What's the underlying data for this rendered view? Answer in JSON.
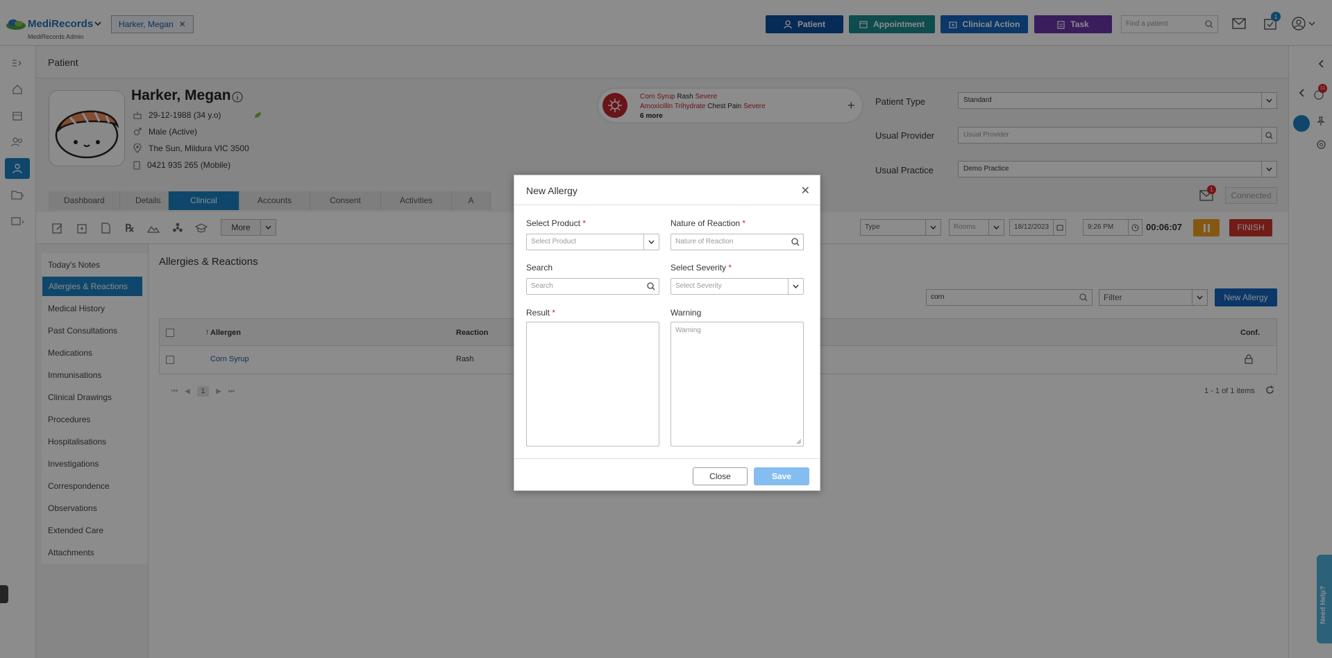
{
  "app": {
    "brand": "MediRecords",
    "subtitle": "MediRecords Admin"
  },
  "open_patient_tab": {
    "label": "Harker, Megan"
  },
  "top_buttons": [
    {
      "label": "Patient",
      "color": "#0d4f9e",
      "icon": "patient-icon"
    },
    {
      "label": "Appointment",
      "color": "#1b8a8c",
      "icon": "calendar-icon"
    },
    {
      "label": "Clinical Action",
      "color": "#1565c0",
      "icon": "clinical-icon"
    },
    {
      "label": "Task",
      "color": "#6a35a8",
      "icon": "task-icon"
    }
  ],
  "find_patient": {
    "placeholder": "Find a patient"
  },
  "notifications": {
    "tasks_badge": "1"
  },
  "page_header": {
    "title": "Patient"
  },
  "patient": {
    "name": "Harker, Megan",
    "dob": "29-12-1988 (34 y.o)",
    "sex": "Male (Active)",
    "address": "The Sun, Mildura VIC 3500",
    "phone": "0421 935 265 (Mobile)"
  },
  "allergy_alert": {
    "line1": {
      "allergen": "Corn Syrup",
      "reaction": "Rash",
      "severity": "Severe"
    },
    "line2": {
      "allergen": "Amoxicillin Trihydrate",
      "reaction": "Chest Pain",
      "severity": "Severe"
    },
    "more": "6 more"
  },
  "patient_fields": {
    "patient_type": {
      "label": "Patient Type",
      "value": "Standard"
    },
    "usual_provider": {
      "label": "Usual Provider",
      "placeholder": "Usual Provider"
    },
    "usual_practice": {
      "label": "Usual Practice",
      "value": "Demo Practice"
    }
  },
  "messages_badge": "1",
  "connected_label": "Connected",
  "tabs": [
    "Dashboard",
    "Details",
    "Clinical",
    "Accounts",
    "Consent",
    "Activities",
    "A"
  ],
  "active_tab": "Clinical",
  "toolbar": {
    "more_label": "More",
    "type_placeholder": "Type",
    "rooms_placeholder": "Rooms",
    "date": "18/12/2023",
    "time": "9:26 PM",
    "timer": "00:06:07",
    "finish_label": "FINISH"
  },
  "side_menu": [
    "Today's Notes",
    "Allergies & Reactions",
    "Medical History",
    "Past Consultations",
    "Medications",
    "Immunisations",
    "Clinical Drawings",
    "Procedures",
    "Hospitalisations",
    "Investigations",
    "Correspondence",
    "Observations",
    "Extended Care",
    "Attachments"
  ],
  "section": {
    "title": "Allergies & Reactions",
    "search_value": "corn",
    "filter_placeholder": "Filter",
    "new_button": "New Allergy"
  },
  "grid": {
    "columns": {
      "allergen": "Allergen",
      "reaction": "Reaction",
      "conf": "Conf."
    },
    "rows": [
      {
        "allergen": "Corn Syrup",
        "reaction": "Rash"
      }
    ],
    "page": "1",
    "summary": "1 - 1 of 1 items"
  },
  "modal": {
    "title": "New Allergy",
    "select_product": {
      "label": "Select Product",
      "placeholder": "Select Product"
    },
    "nature_of_reaction": {
      "label": "Nature of Reaction",
      "placeholder": "Nature of Reaction"
    },
    "search": {
      "label": "Search",
      "placeholder": "Search"
    },
    "select_severity": {
      "label": "Select Severity",
      "placeholder": "Select Severity"
    },
    "result": {
      "label": "Result"
    },
    "warning": {
      "label": "Warning",
      "placeholder": "Warning"
    },
    "close_label": "Close",
    "save_label": "Save",
    "required_marker": "*"
  },
  "rail": {
    "alerts_badge": "11"
  },
  "help_tab": "Need Help?"
}
